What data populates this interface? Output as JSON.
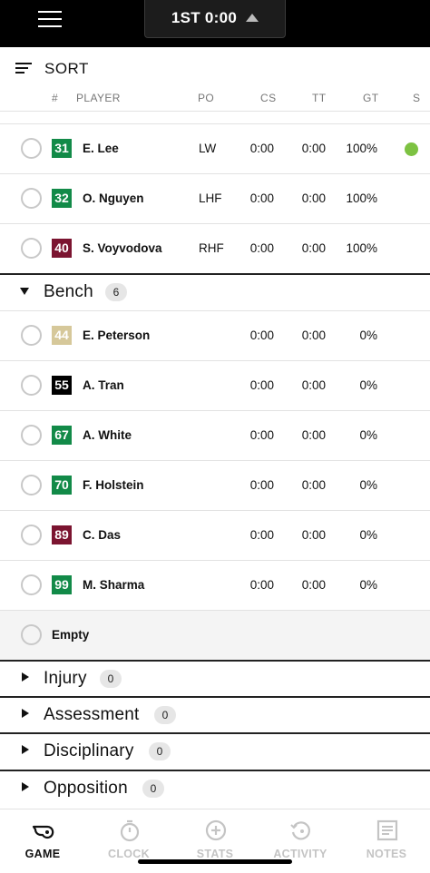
{
  "header": {
    "period_clock": "1ST  0:00"
  },
  "sort": {
    "label": "SORT"
  },
  "columns": {
    "num": "#",
    "player": "PLAYER",
    "po": "PO",
    "cs": "CS",
    "tt": "TT",
    "gt": "GT",
    "s": "S"
  },
  "on_ice": [
    {
      "number": "31",
      "name": "E. Lee",
      "position": "LW",
      "cs": "0:00",
      "tt": "0:00",
      "gt": "100%",
      "color": "#128a48",
      "status": "active"
    },
    {
      "number": "32",
      "name": "O. Nguyen",
      "position": "LHF",
      "cs": "0:00",
      "tt": "0:00",
      "gt": "100%",
      "color": "#128a48"
    },
    {
      "number": "40",
      "name": "S. Voyvodova",
      "position": "RHF",
      "cs": "0:00",
      "tt": "0:00",
      "gt": "100%",
      "color": "#7b1430"
    }
  ],
  "bench": {
    "title": "Bench",
    "count": "6",
    "players": [
      {
        "number": "44",
        "name": "E. Peterson",
        "position": "",
        "cs": "0:00",
        "tt": "0:00",
        "gt": "0%",
        "color": "#d6c89a"
      },
      {
        "number": "55",
        "name": "A. Tran",
        "position": "",
        "cs": "0:00",
        "tt": "0:00",
        "gt": "0%",
        "color": "#000000"
      },
      {
        "number": "67",
        "name": "A. White",
        "position": "",
        "cs": "0:00",
        "tt": "0:00",
        "gt": "0%",
        "color": "#128a48"
      },
      {
        "number": "70",
        "name": "F. Holstein",
        "position": "",
        "cs": "0:00",
        "tt": "0:00",
        "gt": "0%",
        "color": "#128a48"
      },
      {
        "number": "89",
        "name": "C. Das",
        "position": "",
        "cs": "0:00",
        "tt": "0:00",
        "gt": "0%",
        "color": "#7b1430"
      },
      {
        "number": "99",
        "name": "M. Sharma",
        "position": "",
        "cs": "0:00",
        "tt": "0:00",
        "gt": "0%",
        "color": "#128a48"
      }
    ],
    "empty_label": "Empty"
  },
  "sections": [
    {
      "title": "Injury",
      "count": "0"
    },
    {
      "title": "Assessment",
      "count": "0"
    },
    {
      "title": "Disciplinary",
      "count": "0"
    },
    {
      "title": "Opposition",
      "count": "0"
    }
  ],
  "nav": [
    {
      "label": "GAME",
      "icon": "whistle-icon",
      "active": true
    },
    {
      "label": "CLOCK",
      "icon": "stopwatch-icon",
      "active": false
    },
    {
      "label": "STATS",
      "icon": "plus-circle-icon",
      "active": false
    },
    {
      "label": "ACTIVITY",
      "icon": "history-icon",
      "active": false
    },
    {
      "label": "NOTES",
      "icon": "notes-icon",
      "active": false
    }
  ]
}
